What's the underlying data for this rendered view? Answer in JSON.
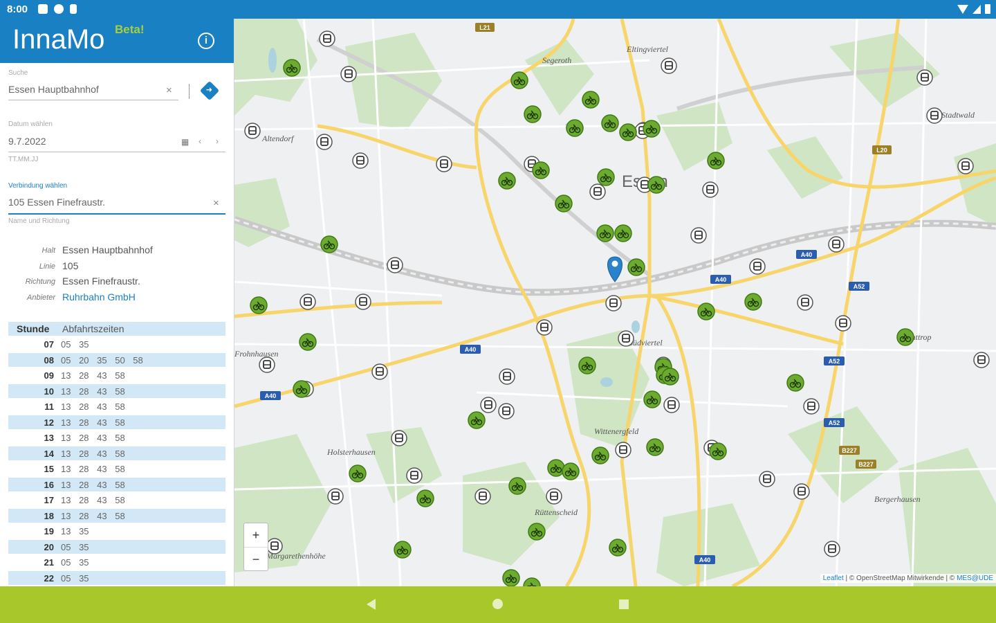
{
  "status": {
    "time": "8:00"
  },
  "app": {
    "logo_left": "Inna",
    "logo_right": "Mo",
    "beta": "Beta!",
    "info_icon": "i"
  },
  "search": {
    "label": "Suche",
    "value": "Essen Hauptbahnhof"
  },
  "date": {
    "label": "Datum wählen",
    "value": "9.7.2022",
    "hint": "TT.MM.JJ"
  },
  "connection": {
    "label": "Verbindung wählen",
    "value": "105 Essen Finefraustr.",
    "hint": "Name und Richtung"
  },
  "details": [
    {
      "key": "Halt",
      "value": "Essen Hauptbahnhof"
    },
    {
      "key": "Linie",
      "value": "105"
    },
    {
      "key": "Richtung",
      "value": "Essen Finefraustr."
    },
    {
      "key": "Anbieter",
      "value": "Ruhrbahn GmbH",
      "link": true
    }
  ],
  "timetable": {
    "header_hour": "Stunde",
    "header_times": "Abfahrtszeiten",
    "rows": [
      {
        "hour": "07",
        "minutes": "05 35"
      },
      {
        "hour": "08",
        "minutes": "05 20 35 50 58"
      },
      {
        "hour": "09",
        "minutes": "13 28 43 58"
      },
      {
        "hour": "10",
        "minutes": "13 28 43 58"
      },
      {
        "hour": "11",
        "minutes": "13 28 43 58"
      },
      {
        "hour": "12",
        "minutes": "13 28 43 58"
      },
      {
        "hour": "13",
        "minutes": "13 28 43 58"
      },
      {
        "hour": "14",
        "minutes": "13 28 43 58"
      },
      {
        "hour": "15",
        "minutes": "13 28 43 58"
      },
      {
        "hour": "16",
        "minutes": "13 28 43 58"
      },
      {
        "hour": "17",
        "minutes": "13 28 43 58"
      },
      {
        "hour": "18",
        "minutes": "13 28 43 58"
      },
      {
        "hour": "19",
        "minutes": "13 35"
      },
      {
        "hour": "20",
        "minutes": "05 35"
      },
      {
        "hour": "21",
        "minutes": "05 35"
      },
      {
        "hour": "22",
        "minutes": "05 35"
      }
    ]
  },
  "map": {
    "places": [
      "Segeroth",
      "Eltingviertel",
      "Essen",
      "Huttrop",
      "Holsterhausen",
      "Rüttenscheid",
      "Bergerhausen",
      "Margarethenhöhe",
      "Frohnhausen",
      "Südviertel",
      "Altendorf",
      "Stadtwald",
      "Wittenergfeld"
    ],
    "road_labels": [
      "A40",
      "A40",
      "A40",
      "A40",
      "A52",
      "A52",
      "A52",
      "L20",
      "L21",
      "B227",
      "B227",
      "A40"
    ],
    "zoom_in": "+",
    "zoom_out": "−",
    "attribution_link": "Leaflet",
    "attribution_text": " | © OpenStreetMap Mitwirkende | © ",
    "attribution_link2": "MES@UDE"
  },
  "colors": {
    "primary": "#1a80c4",
    "accent": "#a8c72a",
    "bike": "#6cab30"
  }
}
